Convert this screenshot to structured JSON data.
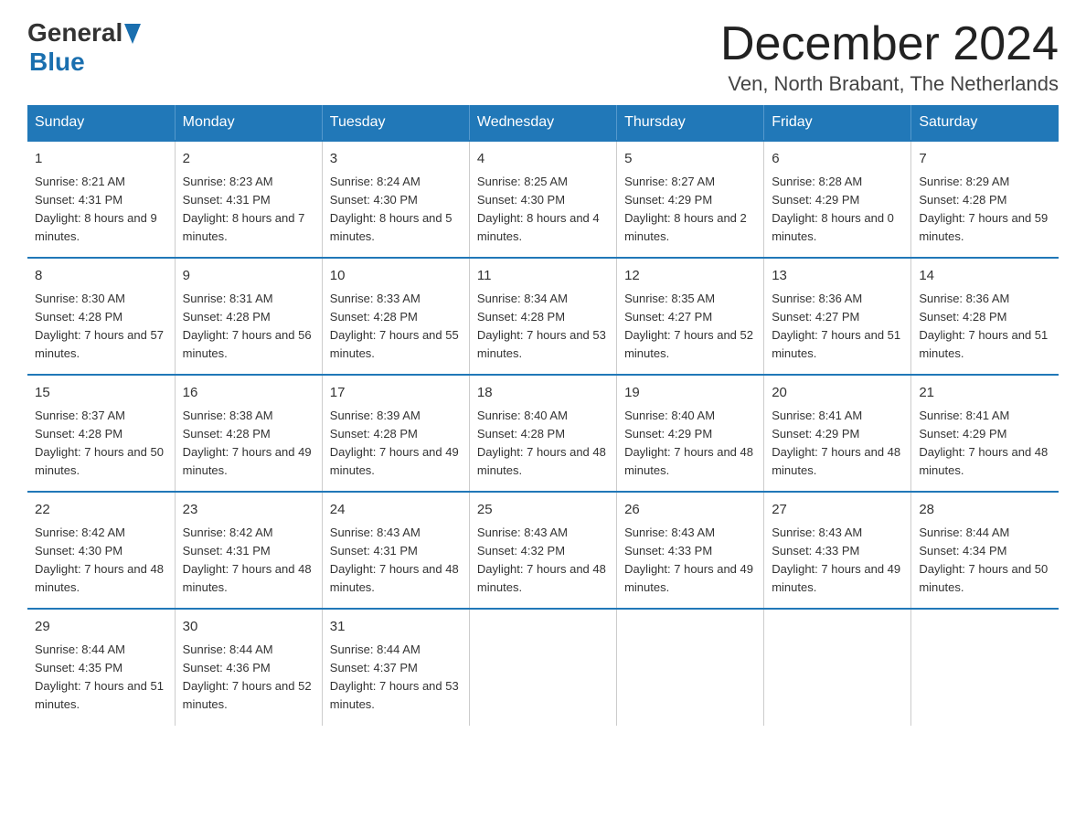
{
  "header": {
    "logo_general": "General",
    "logo_blue": "Blue",
    "title": "December 2024",
    "subtitle": "Ven, North Brabant, The Netherlands"
  },
  "calendar": {
    "headers": [
      "Sunday",
      "Monday",
      "Tuesday",
      "Wednesday",
      "Thursday",
      "Friday",
      "Saturday"
    ],
    "weeks": [
      [
        {
          "day": "1",
          "sunrise": "8:21 AM",
          "sunset": "4:31 PM",
          "daylight": "8 hours and 9 minutes."
        },
        {
          "day": "2",
          "sunrise": "8:23 AM",
          "sunset": "4:31 PM",
          "daylight": "8 hours and 7 minutes."
        },
        {
          "day": "3",
          "sunrise": "8:24 AM",
          "sunset": "4:30 PM",
          "daylight": "8 hours and 5 minutes."
        },
        {
          "day": "4",
          "sunrise": "8:25 AM",
          "sunset": "4:30 PM",
          "daylight": "8 hours and 4 minutes."
        },
        {
          "day": "5",
          "sunrise": "8:27 AM",
          "sunset": "4:29 PM",
          "daylight": "8 hours and 2 minutes."
        },
        {
          "day": "6",
          "sunrise": "8:28 AM",
          "sunset": "4:29 PM",
          "daylight": "8 hours and 0 minutes."
        },
        {
          "day": "7",
          "sunrise": "8:29 AM",
          "sunset": "4:28 PM",
          "daylight": "7 hours and 59 minutes."
        }
      ],
      [
        {
          "day": "8",
          "sunrise": "8:30 AM",
          "sunset": "4:28 PM",
          "daylight": "7 hours and 57 minutes."
        },
        {
          "day": "9",
          "sunrise": "8:31 AM",
          "sunset": "4:28 PM",
          "daylight": "7 hours and 56 minutes."
        },
        {
          "day": "10",
          "sunrise": "8:33 AM",
          "sunset": "4:28 PM",
          "daylight": "7 hours and 55 minutes."
        },
        {
          "day": "11",
          "sunrise": "8:34 AM",
          "sunset": "4:28 PM",
          "daylight": "7 hours and 53 minutes."
        },
        {
          "day": "12",
          "sunrise": "8:35 AM",
          "sunset": "4:27 PM",
          "daylight": "7 hours and 52 minutes."
        },
        {
          "day": "13",
          "sunrise": "8:36 AM",
          "sunset": "4:27 PM",
          "daylight": "7 hours and 51 minutes."
        },
        {
          "day": "14",
          "sunrise": "8:36 AM",
          "sunset": "4:28 PM",
          "daylight": "7 hours and 51 minutes."
        }
      ],
      [
        {
          "day": "15",
          "sunrise": "8:37 AM",
          "sunset": "4:28 PM",
          "daylight": "7 hours and 50 minutes."
        },
        {
          "day": "16",
          "sunrise": "8:38 AM",
          "sunset": "4:28 PM",
          "daylight": "7 hours and 49 minutes."
        },
        {
          "day": "17",
          "sunrise": "8:39 AM",
          "sunset": "4:28 PM",
          "daylight": "7 hours and 49 minutes."
        },
        {
          "day": "18",
          "sunrise": "8:40 AM",
          "sunset": "4:28 PM",
          "daylight": "7 hours and 48 minutes."
        },
        {
          "day": "19",
          "sunrise": "8:40 AM",
          "sunset": "4:29 PM",
          "daylight": "7 hours and 48 minutes."
        },
        {
          "day": "20",
          "sunrise": "8:41 AM",
          "sunset": "4:29 PM",
          "daylight": "7 hours and 48 minutes."
        },
        {
          "day": "21",
          "sunrise": "8:41 AM",
          "sunset": "4:29 PM",
          "daylight": "7 hours and 48 minutes."
        }
      ],
      [
        {
          "day": "22",
          "sunrise": "8:42 AM",
          "sunset": "4:30 PM",
          "daylight": "7 hours and 48 minutes."
        },
        {
          "day": "23",
          "sunrise": "8:42 AM",
          "sunset": "4:31 PM",
          "daylight": "7 hours and 48 minutes."
        },
        {
          "day": "24",
          "sunrise": "8:43 AM",
          "sunset": "4:31 PM",
          "daylight": "7 hours and 48 minutes."
        },
        {
          "day": "25",
          "sunrise": "8:43 AM",
          "sunset": "4:32 PM",
          "daylight": "7 hours and 48 minutes."
        },
        {
          "day": "26",
          "sunrise": "8:43 AM",
          "sunset": "4:33 PM",
          "daylight": "7 hours and 49 minutes."
        },
        {
          "day": "27",
          "sunrise": "8:43 AM",
          "sunset": "4:33 PM",
          "daylight": "7 hours and 49 minutes."
        },
        {
          "day": "28",
          "sunrise": "8:44 AM",
          "sunset": "4:34 PM",
          "daylight": "7 hours and 50 minutes."
        }
      ],
      [
        {
          "day": "29",
          "sunrise": "8:44 AM",
          "sunset": "4:35 PM",
          "daylight": "7 hours and 51 minutes."
        },
        {
          "day": "30",
          "sunrise": "8:44 AM",
          "sunset": "4:36 PM",
          "daylight": "7 hours and 52 minutes."
        },
        {
          "day": "31",
          "sunrise": "8:44 AM",
          "sunset": "4:37 PM",
          "daylight": "7 hours and 53 minutes."
        },
        null,
        null,
        null,
        null
      ]
    ],
    "labels": {
      "sunrise": "Sunrise:",
      "sunset": "Sunset:",
      "daylight": "Daylight:"
    }
  }
}
